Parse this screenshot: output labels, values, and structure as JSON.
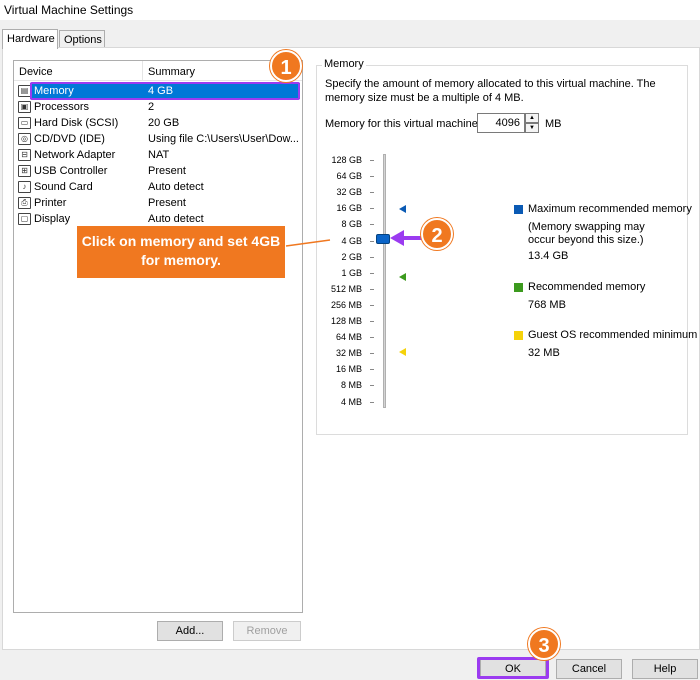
{
  "window": {
    "title": "Virtual Machine Settings"
  },
  "tabs": [
    {
      "label": "Hardware",
      "active": true
    },
    {
      "label": "Options",
      "active": false
    }
  ],
  "device_list": {
    "columns": [
      "Device",
      "Summary"
    ],
    "rows": [
      {
        "device": "Memory",
        "summary": "4 GB",
        "icon": "memory-icon",
        "selected": true
      },
      {
        "device": "Processors",
        "summary": "2",
        "icon": "processor-icon"
      },
      {
        "device": "Hard Disk (SCSI)",
        "summary": "20 GB",
        "icon": "hard-disk-icon"
      },
      {
        "device": "CD/DVD (IDE)",
        "summary": "Using file C:\\Users\\User\\Dow...",
        "icon": "cd-dvd-icon"
      },
      {
        "device": "Network Adapter",
        "summary": "NAT",
        "icon": "network-adapter-icon"
      },
      {
        "device": "USB Controller",
        "summary": "Present",
        "icon": "usb-controller-icon"
      },
      {
        "device": "Sound Card",
        "summary": "Auto detect",
        "icon": "sound-card-icon"
      },
      {
        "device": "Printer",
        "summary": "Present",
        "icon": "printer-icon"
      },
      {
        "device": "Display",
        "summary": "Auto detect",
        "icon": "display-icon"
      }
    ],
    "add_label": "Add...",
    "remove_label": "Remove"
  },
  "memory": {
    "group_title": "Memory",
    "description": "Specify the amount of memory allocated to this virtual machine. The memory size must be a multiple of 4 MB.",
    "field_label": "Memory for this virtual machine:",
    "value": "4096",
    "unit": "MB",
    "scale": [
      "128 GB",
      "64 GB",
      "32 GB",
      "16 GB",
      "8 GB",
      "4 GB",
      "2 GB",
      "1 GB",
      "512 MB",
      "256 MB",
      "128 MB",
      "64 MB",
      "32 MB",
      "16 MB",
      "8 MB",
      "4 MB"
    ],
    "legend": {
      "max_title": "Maximum recommended memory",
      "max_note": "(Memory swapping may occur beyond this size.)",
      "max_value": "13.4 GB",
      "rec_title": "Recommended memory",
      "rec_value": "768 MB",
      "min_title": "Guest OS recommended minimum",
      "min_value": "32 MB"
    },
    "colors": {
      "max": "#0a5ab4",
      "rec": "#3c9a1e",
      "min": "#f5d20a"
    }
  },
  "footer": {
    "ok_label": "OK",
    "cancel_label": "Cancel",
    "help_label": "Help"
  },
  "annotations": {
    "badge1": "1",
    "badge2": "2",
    "badge3": "3",
    "instruction": "Click on memory and set 4GB for memory."
  }
}
